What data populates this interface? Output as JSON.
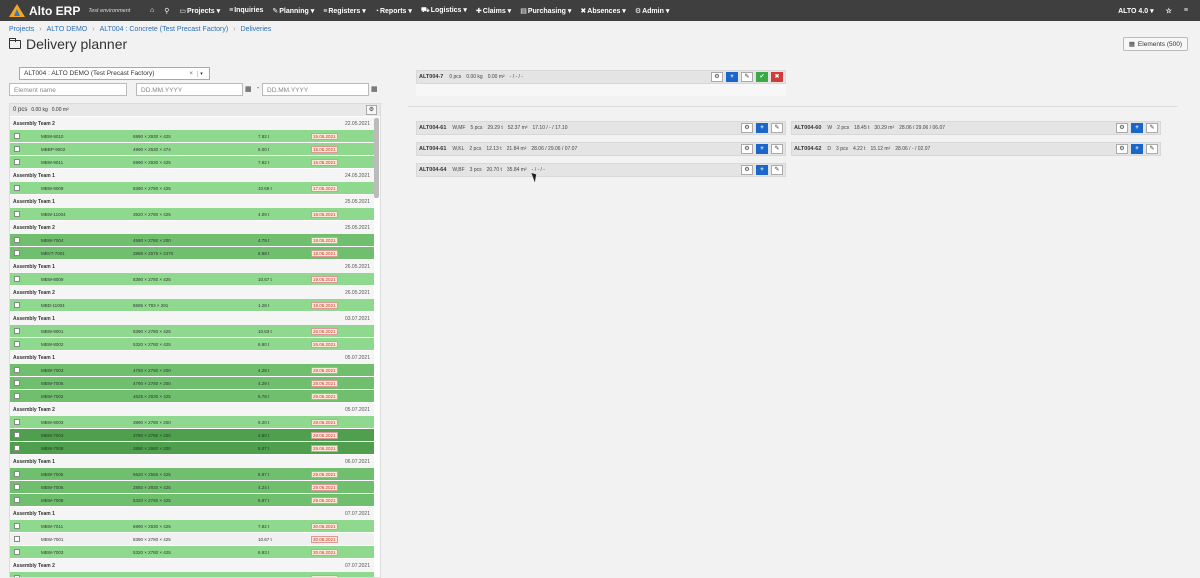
{
  "topbar": {
    "brand": "Alto ERP",
    "env": "Test environment",
    "nav": [
      {
        "icon": "home-icon",
        "label": "",
        "glyph": "⌂"
      },
      {
        "icon": "search-icon",
        "label": "",
        "glyph": "⚲"
      },
      {
        "icon": "folder-icon",
        "label": "Projects ▾",
        "glyph": "▭"
      },
      {
        "icon": "inquiries-icon",
        "label": "Inquiries",
        "glyph": "≡"
      },
      {
        "icon": "wrench-icon",
        "label": "Planning ▾",
        "glyph": "✎"
      },
      {
        "icon": "list-icon",
        "label": "Registers ▾",
        "glyph": "≡"
      },
      {
        "icon": "reports-icon",
        "label": "Reports ▾",
        "glyph": "◔"
      },
      {
        "icon": "truck-icon",
        "label": "Logistics ▾",
        "glyph": "⛟"
      },
      {
        "icon": "claims-icon",
        "label": "Claims ▾",
        "glyph": "✚"
      },
      {
        "icon": "purchasing-icon",
        "label": "Purchasing ▾",
        "glyph": "▤"
      },
      {
        "icon": "absences-icon",
        "label": "Absences ▾",
        "glyph": "✖"
      },
      {
        "icon": "gear-icon",
        "label": "Admin ▾",
        "glyph": "⚙"
      }
    ],
    "user": "ALTO 4.0 ▾",
    "star": "☆",
    "menu": "≡"
  },
  "breadcrumb": [
    "Projects",
    "ALTO DEMO",
    "ALT004 : Concrete (Test Precast Factory)",
    "Deliveries"
  ],
  "page_title": "Delivery planner",
  "elements_button": "Elements (500)",
  "filters": {
    "project_select": "ALT004 : ALTO DEMO (Test Precast Factory)",
    "element_name_placeholder": "Element name",
    "date_from_placeholder": "DD.MM.YYYY",
    "date_to_placeholder": "DD.MM.YYYY",
    "range_sep": "-"
  },
  "left_summary": {
    "pcs": "0 pcs",
    "kg": "0.00 kg",
    "m2": "0.00 m²"
  },
  "groups": [
    {
      "team": "Assembly Team 2",
      "date": "22.05.2021",
      "rows": [
        {
          "c": "lg",
          "name": "MBW-9010",
          "dim": "6990 × 2930 × 425",
          "wt": "7.82 t",
          "due": "15.05.2021"
        },
        {
          "c": "lg",
          "name": "MBBP-9002",
          "dim": "4990 × 2530 × 474",
          "wt": "5.00 t",
          "due": "15.05.2021"
        },
        {
          "c": "lg",
          "name": "MBW-9011",
          "dim": "6990 × 2930 × 425",
          "wt": "7.82 t",
          "due": "15.05.2021"
        }
      ]
    },
    {
      "team": "Assembly Team 1",
      "date": "24.05.2021",
      "rows": [
        {
          "c": "lg",
          "name": "MBW-8009",
          "dim": "8390 × 2780 × 425",
          "wt": "10.69 t",
          "due": "17.05.2021"
        }
      ]
    },
    {
      "team": "Assembly Team 1",
      "date": "25.05.2021",
      "rows": [
        {
          "c": "lg",
          "name": "MBW-11004",
          "dim": "3920 × 2780 × 425",
          "wt": "4.09 t",
          "due": "18.05.2021"
        }
      ]
    },
    {
      "team": "Assembly Team 2",
      "date": "25.05.2021",
      "rows": [
        {
          "c": "mg",
          "name": "MBW-7004",
          "dim": "4590 × 2780 × 200",
          "wt": "4.79 t",
          "due": "18.05.2021"
        },
        {
          "c": "mg",
          "name": "MBVT-7001",
          "dim": "2898 × 2675 × 2470",
          "wt": "6.88 t",
          "due": "18.05.2021"
        }
      ]
    },
    {
      "team": "Assembly Team 1",
      "date": "26.05.2021",
      "rows": [
        {
          "c": "lg",
          "name": "MBW-8009",
          "dim": "8390 × 2780 × 425",
          "wt": "10.67 t",
          "due": "19.05.2021"
        }
      ]
    },
    {
      "team": "Assembly Team 2",
      "date": "26.05.2021",
      "rows": [
        {
          "c": "lg",
          "name": "MBD-11004",
          "dim": "5595 × 793 × 291",
          "wt": "1.28 t",
          "due": "19.05.2021"
        }
      ]
    },
    {
      "team": "Assembly Team 1",
      "date": "03.07.2021",
      "rows": [
        {
          "c": "lg",
          "name": "MBW-8001",
          "dim": "8390 × 2780 × 425",
          "wt": "10.63 t",
          "due": "26.06.2021"
        },
        {
          "c": "lg",
          "name": "MBW-8002",
          "dim": "5320 × 2780 × 425",
          "wt": "6.90 t",
          "due": "26.06.2021"
        }
      ]
    },
    {
      "team": "Assembly Team 1",
      "date": "05.07.2021",
      "rows": [
        {
          "c": "mg",
          "name": "MBW-7003",
          "dim": "4750 × 2780 × 200",
          "wt": "4.28 t",
          "due": "28.06.2021"
        },
        {
          "c": "mg",
          "name": "MBW-7006",
          "dim": "4790 × 2780 × 200",
          "wt": "4.29 t",
          "due": "28.06.2021"
        },
        {
          "c": "mg",
          "name": "MBW-7002",
          "dim": "4625 × 2930 × 425",
          "wt": "5.78 t",
          "due": "28.06.2021"
        }
      ]
    },
    {
      "team": "Assembly Team 2",
      "date": "05.07.2021",
      "rows": [
        {
          "c": "lg",
          "name": "MBW-8003",
          "dim": "3990 × 2780 × 200",
          "wt": "9.20 t",
          "due": "28.06.2021"
        },
        {
          "c": "dg",
          "name": "MBW-7003",
          "dim": "3790 × 2780 × 200",
          "wt": "4.60 t",
          "due": "28.06.2021"
        },
        {
          "c": "dg",
          "name": "MBW-7008",
          "dim": "3890 × 2680 × 200",
          "wt": "5.07 t",
          "due": "28.06.2021"
        }
      ]
    },
    {
      "team": "Assembly Team 1",
      "date": "06.07.2021",
      "rows": [
        {
          "c": "mg",
          "name": "MBW-7005",
          "dim": "5620 × 2565 × 425",
          "wt": "6.97 t",
          "due": "29.06.2021"
        },
        {
          "c": "mg",
          "name": "MBW-7006",
          "dim": "2850 × 2930 × 425",
          "wt": "4.24 t",
          "due": "29.06.2021"
        },
        {
          "c": "mg",
          "name": "MBW-7008",
          "dim": "5320 × 2780 × 425",
          "wt": "6.97 t",
          "due": "29.06.2021"
        }
      ]
    },
    {
      "team": "Assembly Team 1",
      "date": "07.07.2021",
      "rows": [
        {
          "c": "lg",
          "name": "MBW-7011",
          "dim": "6990 × 2930 × 425",
          "wt": "7.82 t",
          "due": "30.06.2021"
        },
        {
          "c": "ng",
          "name": "MBW-7001",
          "dim": "8390 × 2780 × 425",
          "wt": "10.67 t",
          "due": "30.06.2021"
        },
        {
          "c": "lg",
          "name": "MBW-7003",
          "dim": "5320 × 2780 × 425",
          "wt": "6.93 t",
          "due": "30.06.2021"
        }
      ]
    },
    {
      "team": "Assembly Team 2",
      "date": "07.07.2021",
      "rows": [
        {
          "c": "lg",
          "name": "MBWP-7003",
          "dim": "4590 × 2510 × 200",
          "wt": "4.41 t",
          "due": "30.06.2021"
        }
      ]
    }
  ],
  "top_delivery": {
    "id": "ALT004-7",
    "pcs": "0 pcs",
    "kg": "0.00 kg",
    "m2": "0.00 m²",
    "dates": "- / - / -"
  },
  "deliveries": [
    {
      "id": "ALT004-61",
      "type": "W,MF",
      "pcs": "5 pcs",
      "t": "29.29 t",
      "m2": "52.37 m²",
      "dates": "17.10 / - / 17.10"
    },
    {
      "id": "ALT004-60",
      "type": "W",
      "pcs": "2 pcs",
      "t": "18.45 t",
      "m2": "30.29 m²",
      "dates": "28.06 / 29.06 / 06.07"
    },
    {
      "id": "ALT004-61",
      "type": "W,KL",
      "pcs": "2 pcs",
      "t": "12.13 t",
      "m2": "21.84 m²",
      "dates": "28.06 / 29.06 / 07.07"
    },
    {
      "id": "ALT004-62",
      "type": "D",
      "pcs": "3 pcs",
      "t": "4.22 t",
      "m2": "15.12 m²",
      "dates": "28.06 / - / 02.07"
    },
    {
      "id": "ALT004-64",
      "type": "W,BF",
      "pcs": "3 pcs",
      "t": "20.70 t",
      "m2": "35.84 m²",
      "dates": "- / - / -"
    }
  ],
  "colors": {
    "topbar": "#3f3f3f",
    "light_green": "#8fd98f",
    "mid_green": "#6fbf6f",
    "dark_green": "#4f9f4f",
    "primary": "#1a66c9",
    "success": "#3aaa45",
    "danger": "#d23a3a"
  }
}
